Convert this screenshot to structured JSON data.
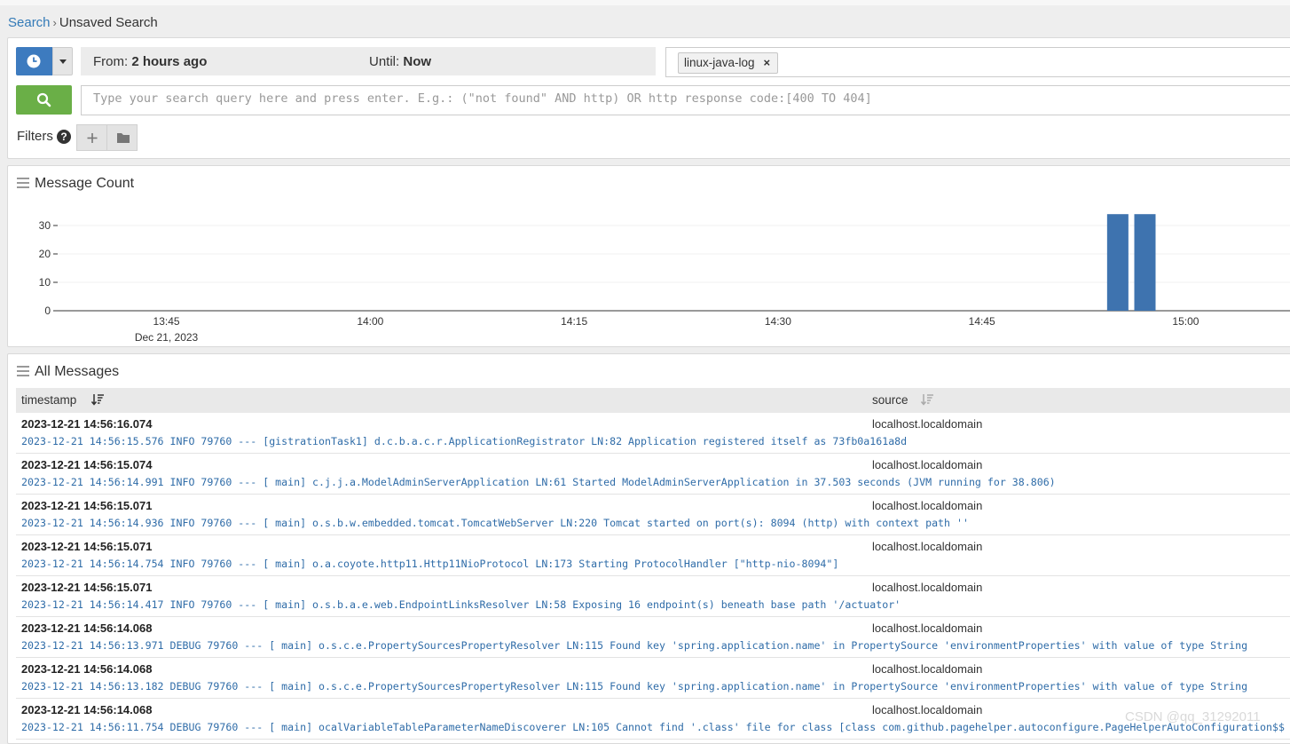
{
  "breadcrumb": {
    "root": "Search",
    "separator": "›",
    "current": "Unsaved Search"
  },
  "time_range": {
    "from_label": "From:",
    "from_value": "2 hours ago",
    "until_label": "Until:",
    "until_value": "Now"
  },
  "stream_chip": {
    "label": "linux-java-log",
    "remove_label": "×"
  },
  "search": {
    "placeholder": "Type your search query here and press enter. E.g.: (\"not found\" AND http) OR http response code:[400 TO 404]"
  },
  "filters": {
    "label": "Filters",
    "help": "?"
  },
  "icons": {
    "time": "clock-icon",
    "dropdown": "caret-down-icon",
    "search": "magnifier-icon",
    "add": "plus-icon",
    "folder": "folder-icon",
    "menu": "hamburger-icon",
    "sort": "sort-desc-icon"
  },
  "colors": {
    "primary": "#3d7bbf",
    "success": "#6aaf47",
    "bar": "#3e73af",
    "message_text": "#2f6ca8"
  },
  "message_count": {
    "title": "Message Count",
    "date_label": "Dec 21, 2023"
  },
  "chart_data": {
    "type": "bar",
    "title": "Message Count",
    "x_ticks": [
      "13:45",
      "14:00",
      "14:15",
      "14:30",
      "14:45",
      "15:00"
    ],
    "y_ticks": [
      0,
      10,
      20,
      30
    ],
    "ylim": [
      0,
      40
    ],
    "x_range": [
      "13:37",
      "15:08"
    ],
    "bars": [
      {
        "x": "14:55",
        "value": 34
      },
      {
        "x": "14:57",
        "value": 34
      }
    ]
  },
  "messages": {
    "title": "All Messages",
    "columns": {
      "timestamp": "timestamp",
      "source": "source"
    },
    "rows": [
      {
        "timestamp": "2023-12-21 14:56:16.074",
        "source": "localhost.localdomain",
        "message": "2023-12-21 14:56:15.576 INFO 79760 --- [gistrationTask1] d.c.b.a.c.r.ApplicationRegistrator LN:82 Application registered itself as 73fb0a161a8d"
      },
      {
        "timestamp": "2023-12-21 14:56:15.074",
        "source": "localhost.localdomain",
        "message": "2023-12-21 14:56:14.991 INFO 79760 --- [ main] c.j.j.a.ModelAdminServerApplication LN:61 Started ModelAdminServerApplication in 37.503 seconds (JVM running for 38.806)"
      },
      {
        "timestamp": "2023-12-21 14:56:15.071",
        "source": "localhost.localdomain",
        "message": "2023-12-21 14:56:14.936 INFO 79760 --- [ main] o.s.b.w.embedded.tomcat.TomcatWebServer LN:220 Tomcat started on port(s): 8094 (http) with context path ''"
      },
      {
        "timestamp": "2023-12-21 14:56:15.071",
        "source": "localhost.localdomain",
        "message": "2023-12-21 14:56:14.754 INFO 79760 --- [ main] o.a.coyote.http11.Http11NioProtocol LN:173 Starting ProtocolHandler [\"http-nio-8094\"]"
      },
      {
        "timestamp": "2023-12-21 14:56:15.071",
        "source": "localhost.localdomain",
        "message": "2023-12-21 14:56:14.417 INFO 79760 --- [ main] o.s.b.a.e.web.EndpointLinksResolver LN:58 Exposing 16 endpoint(s) beneath base path '/actuator'"
      },
      {
        "timestamp": "2023-12-21 14:56:14.068",
        "source": "localhost.localdomain",
        "message": "2023-12-21 14:56:13.971 DEBUG 79760 --- [ main] o.s.c.e.PropertySourcesPropertyResolver LN:115 Found key 'spring.application.name' in PropertySource 'environmentProperties' with value of type String"
      },
      {
        "timestamp": "2023-12-21 14:56:14.068",
        "source": "localhost.localdomain",
        "message": "2023-12-21 14:56:13.182 DEBUG 79760 --- [ main] o.s.c.e.PropertySourcesPropertyResolver LN:115 Found key 'spring.application.name' in PropertySource 'environmentProperties' with value of type String"
      },
      {
        "timestamp": "2023-12-21 14:56:14.068",
        "source": "localhost.localdomain",
        "message": "2023-12-21 14:56:11.754 DEBUG 79760 --- [ main] ocalVariableTableParameterNameDiscoverer LN:105 Cannot find '.class' file for class [class com.github.pagehelper.autoconfigure.PageHelperAutoConfiguration$$"
      }
    ]
  },
  "watermark": "CSDN @qq_31292011"
}
